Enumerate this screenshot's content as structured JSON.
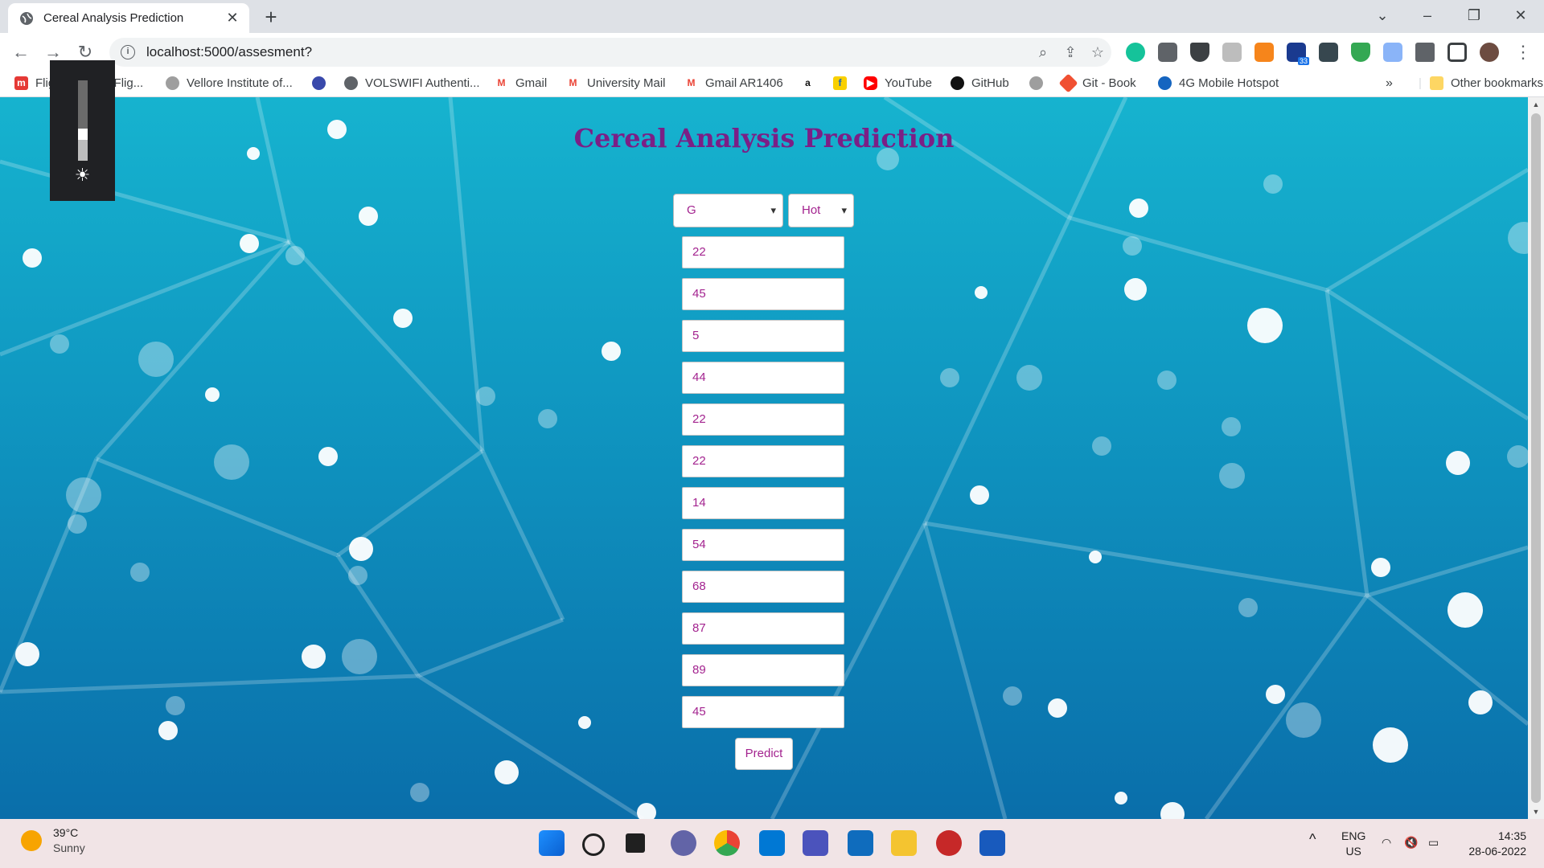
{
  "browser": {
    "tab_title": "Cereal Analysis Prediction",
    "tab_close": "✕",
    "new_tab": "+",
    "url": "localhost:5000/assesment?",
    "window_controls": {
      "dropdown": "⌄",
      "minimize": "–",
      "restore": "❐",
      "close": "✕"
    },
    "nav": {
      "back": "←",
      "forward": "→",
      "reload": "↻"
    },
    "menu": "⋮",
    "extension_badge": "33"
  },
  "bookmarks": [
    {
      "label": "Flight, Flights, Flig...",
      "icon": "makemytrip-icon",
      "color": "#e53935"
    },
    {
      "label": "Vellore Institute of...",
      "icon": "vit-icon",
      "color": "#9e9e9e"
    },
    {
      "label": "",
      "icon": "dsc-icon",
      "color": "#3949ab"
    },
    {
      "label": "VOLSWIFI Authenti...",
      "icon": "globe-icon",
      "color": "#5f6368"
    },
    {
      "label": "Gmail",
      "icon": "gmail-icon",
      "color": "#ea4335"
    },
    {
      "label": "University Mail",
      "icon": "gmail-icon",
      "color": "#ea4335"
    },
    {
      "label": "Gmail AR1406",
      "icon": "gmail-icon",
      "color": "#ea4335"
    },
    {
      "label": "",
      "icon": "amazon-icon",
      "color": "#111111"
    },
    {
      "label": "",
      "icon": "flipkart-icon",
      "color": "#f9d000"
    },
    {
      "label": "YouTube",
      "icon": "youtube-icon",
      "color": "#ff0000"
    },
    {
      "label": "GitHub",
      "icon": "github-icon",
      "color": "#111111"
    },
    {
      "label": "",
      "icon": "vit-icon",
      "color": "#9e9e9e"
    },
    {
      "label": "Git - Book",
      "icon": "git-icon",
      "color": "#f05032"
    },
    {
      "label": "4G Mobile Hotspot",
      "icon": "hotspot-icon",
      "color": "#1565c0"
    }
  ],
  "bookmarks_more": "»",
  "other_bookmarks": "Other bookmarks",
  "page": {
    "title": "Cereal Analysis Prediction",
    "select_mfr": "G",
    "select_type": "Hot",
    "fields": [
      "22",
      "45",
      "5",
      "44",
      "22",
      "22",
      "14",
      "54",
      "68",
      "87",
      "89",
      "45"
    ],
    "predict_label": "Predict"
  },
  "taskbar": {
    "temperature": "39°C",
    "condition": "Sunny",
    "lang": "ENG",
    "region": "US",
    "time": "14:35",
    "date": "28-06-2022"
  },
  "colors": {
    "title": "#7b1f86",
    "field_text": "#a3238f",
    "page_top": "#16b3cf",
    "page_bottom": "#0a6eaa"
  }
}
